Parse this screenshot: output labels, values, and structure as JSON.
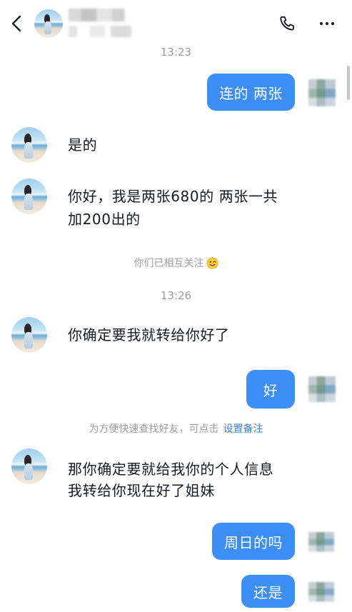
{
  "header": {
    "back_icon": "chevron-left-icon",
    "call_icon": "phone-icon",
    "more_icon": "more-icon"
  },
  "chat": {
    "timestamps": [
      "13:23",
      "13:26"
    ],
    "sent": [
      "连的 两张",
      "好",
      "周日的吗",
      "还是"
    ],
    "received": [
      {
        "lines": [
          "是的"
        ]
      },
      {
        "lines": [
          "你好，我是两张680的 两张一共",
          "加200出的"
        ]
      },
      {
        "lines": [
          "你确定要我就转给你好了"
        ]
      },
      {
        "lines": [
          "那你确定要就给我你的个人信息",
          "我转给你现在好了姐妹"
        ]
      }
    ],
    "notices": [
      {
        "text": "你们已相互关注",
        "emoji_icon": "wink-emoji-icon"
      },
      {
        "text": "为方便快速查找好友，可点击",
        "link": "设置备注"
      }
    ]
  },
  "colors": {
    "sent_bubble": "#3d8ef6",
    "link": "#3e7fd6",
    "meta_text": "#9a9a9a"
  }
}
